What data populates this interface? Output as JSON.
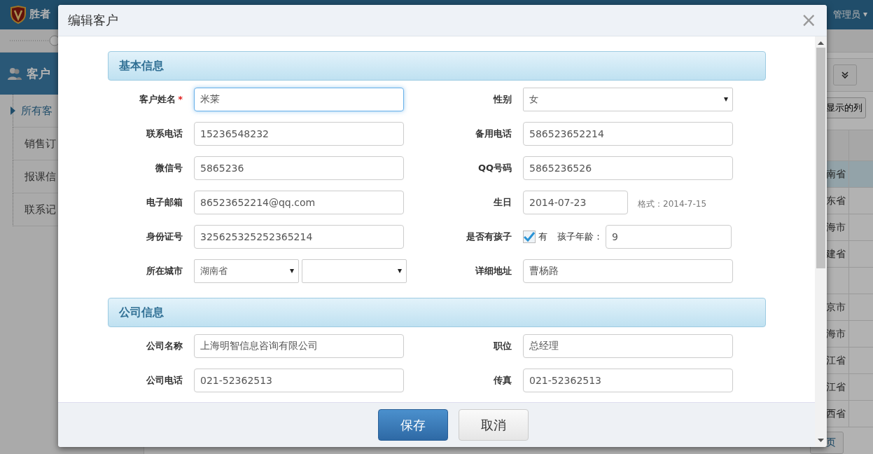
{
  "app": {
    "brand": "胜者",
    "user": "管理员",
    "sidebar": {
      "section": "客户",
      "items": [
        {
          "label": "所有客",
          "selected": true
        },
        {
          "label": "销售订",
          "selected": false
        },
        {
          "label": "报课信",
          "selected": false
        },
        {
          "label": "联系记",
          "selected": false
        }
      ]
    },
    "columns_button": "显示的列",
    "table": {
      "rows": [
        {
          "column_1": "南省",
          "selected": true
        },
        {
          "column_1": "东省",
          "selected": false
        },
        {
          "column_1": "海市",
          "selected": false
        },
        {
          "column_1": "建省",
          "selected": false
        },
        {
          "selected": false
        },
        {
          "column_1": "京市",
          "selected": false
        },
        {
          "column_1": "海市",
          "selected": false
        },
        {
          "column_1": "江省",
          "selected": false
        },
        {
          "column_1": "江省",
          "selected": false
        },
        {
          "column_1": "西省",
          "selected": false
        }
      ]
    },
    "pager_button": "页"
  },
  "dialog": {
    "title": "编辑客户",
    "close": "×",
    "sections": [
      {
        "title": "基本信息",
        "rows": [
          [
            {
              "kind": "text",
              "label": "客户姓名",
              "required_mark": "*",
              "focused": true,
              "value": "米莱"
            },
            {
              "kind": "select",
              "label": "性别",
              "value": "女"
            }
          ],
          [
            {
              "kind": "text",
              "label": "联系电话",
              "value": "15236548232"
            },
            {
              "kind": "text",
              "label": "备用电话",
              "value": "586523652214"
            }
          ],
          [
            {
              "kind": "text",
              "label": "微信号",
              "value": "5865236"
            },
            {
              "kind": "text",
              "label": "QQ号码",
              "value": "5865236526"
            }
          ],
          [
            {
              "kind": "text",
              "label": "电子邮箱",
              "value": "86523652214@qq.com"
            },
            {
              "kind": "date",
              "label": "生日",
              "value": "2014-07-23",
              "hint": "格式：2014-7-15"
            }
          ],
          [
            {
              "kind": "text",
              "label": "身份证号",
              "value": "325625325252365214"
            },
            {
              "kind": "child",
              "label": "是否有孩子",
              "checked": true,
              "check_label": "有",
              "age_label": "孩子年龄：",
              "value": "9"
            }
          ],
          [
            {
              "kind": "city",
              "label": "所在城市",
              "value": "湖南省"
            },
            {
              "kind": "text",
              "label": "详细地址",
              "value": "曹杨路"
            }
          ]
        ]
      },
      {
        "title": "公司信息",
        "rows": [
          [
            {
              "kind": "text",
              "label": "公司名称",
              "value": "上海明智信息咨询有限公司"
            },
            {
              "kind": "text",
              "label": "职位",
              "value": "总经理"
            }
          ],
          [
            {
              "kind": "text",
              "label": "公司电话",
              "value": "021-52362513"
            },
            {
              "kind": "text",
              "label": "传真",
              "value": "021-52362513"
            }
          ]
        ]
      }
    ],
    "buttons": [
      {
        "label": "保存",
        "kind": "primary"
      },
      {
        "label": "取消",
        "kind": "default"
      }
    ]
  }
}
